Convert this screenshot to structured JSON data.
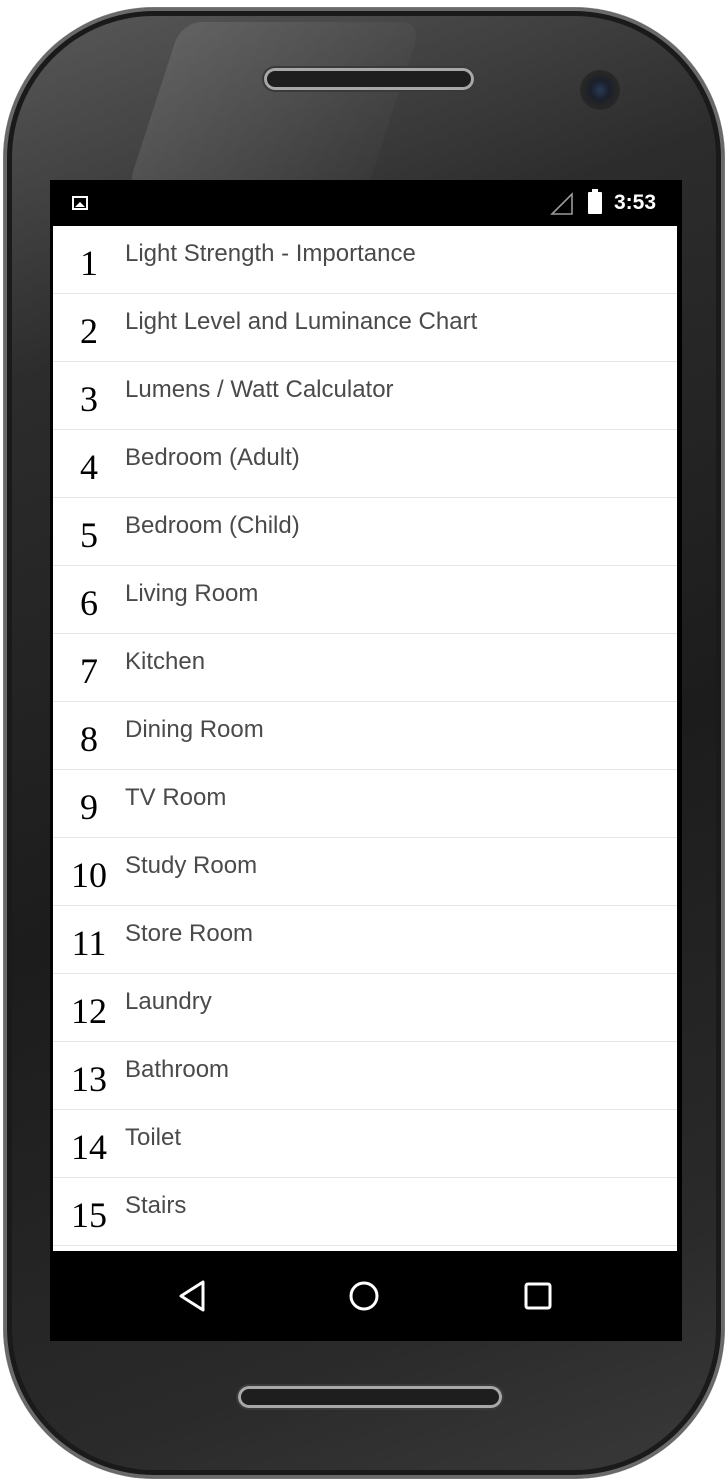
{
  "status_bar": {
    "time": "3:53",
    "icons": [
      "picture-icon",
      "signal-icon",
      "battery-icon"
    ]
  },
  "list": {
    "items": [
      {
        "number": "1",
        "label": "Light Strength - Importance"
      },
      {
        "number": "2",
        "label": "Light Level and Luminance Chart"
      },
      {
        "number": "3",
        "label": "Lumens / Watt Calculator"
      },
      {
        "number": "4",
        "label": "Bedroom (Adult)"
      },
      {
        "number": "5",
        "label": "Bedroom (Child)"
      },
      {
        "number": "6",
        "label": "Living Room"
      },
      {
        "number": "7",
        "label": "Kitchen"
      },
      {
        "number": "8",
        "label": "Dining Room"
      },
      {
        "number": "9",
        "label": "TV Room"
      },
      {
        "number": "10",
        "label": "Study Room"
      },
      {
        "number": "11",
        "label": "Store Room"
      },
      {
        "number": "12",
        "label": "Laundry"
      },
      {
        "number": "13",
        "label": "Bathroom"
      },
      {
        "number": "14",
        "label": "Toilet"
      },
      {
        "number": "15",
        "label": "Stairs"
      }
    ]
  },
  "nav_bar": {
    "buttons": [
      "back-icon",
      "home-icon",
      "recent-apps-icon"
    ]
  },
  "colors": {
    "screen_background": "#000000",
    "list_background": "#ffffff",
    "label_text": "#4a4a4a",
    "number_text": "#000000",
    "divider": "#e6e6e6"
  }
}
